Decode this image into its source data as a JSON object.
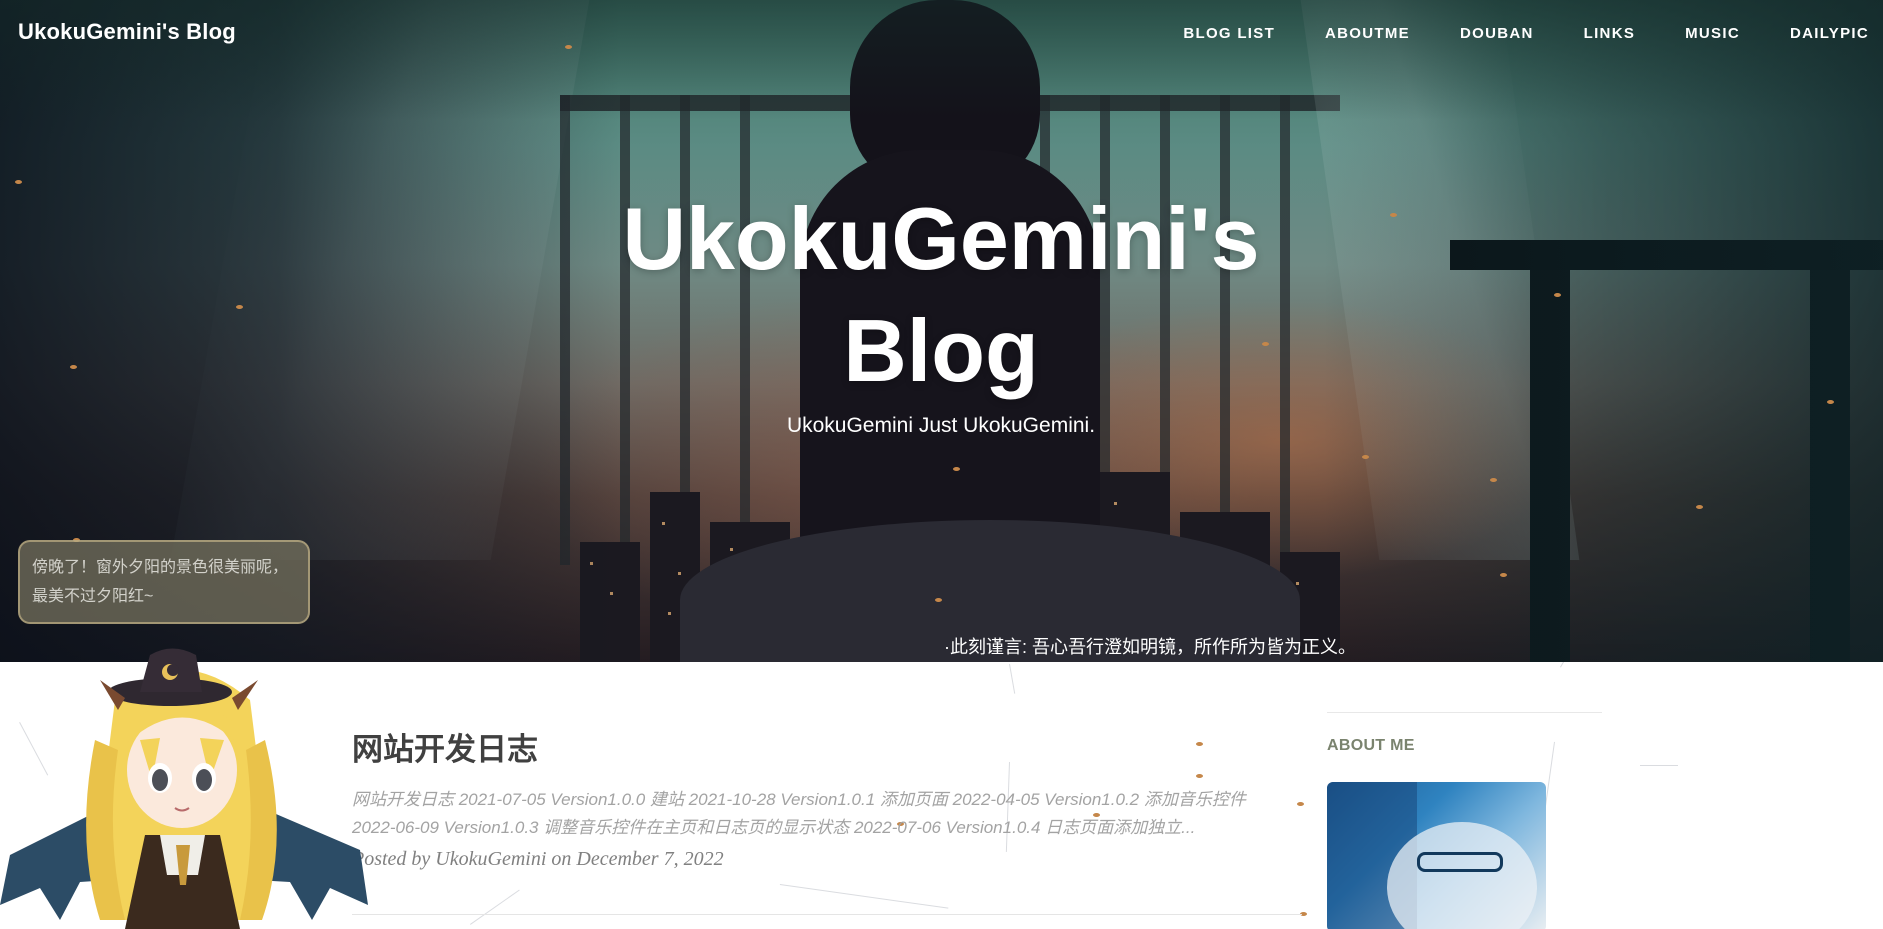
{
  "site": {
    "brand": "UkokuGemini's Blog"
  },
  "nav": {
    "items": [
      {
        "label": "BLOG LIST"
      },
      {
        "label": "ABOUTME"
      },
      {
        "label": "DOUBAN"
      },
      {
        "label": "LINKS"
      },
      {
        "label": "MUSIC"
      },
      {
        "label": "DAILYPIC"
      }
    ]
  },
  "hero": {
    "title_line1": "UkokuGemini's",
    "title_line2": "Blog",
    "subtitle": "UkokuGemini Just UkokuGemini.",
    "quote": "·此刻谨言: 吾心吾行澄如明镜，所作所为皆为正义。"
  },
  "mascot": {
    "bubble_line1": "傍晚了！窗外夕阳的景色很美丽呢，",
    "bubble_line2": "最美不过夕阳红~"
  },
  "post": {
    "title": "网站开发日志",
    "excerpt_line1": "网站开发日志 2021-07-05 Version1.0.0 建站 2021-10-28 Version1.0.1 添加页面 2022-04-05 Version1.0.2 添加音乐控件",
    "excerpt_line2": "2022-06-09 Version1.0.3 调整音乐控件在主页和日志页的显示状态 2022-07-06 Version1.0.4 日志页面添加独立...",
    "meta": "Posted by UkokuGemini on December 7, 2022"
  },
  "sidebar": {
    "heading": "ABOUT ME"
  }
}
